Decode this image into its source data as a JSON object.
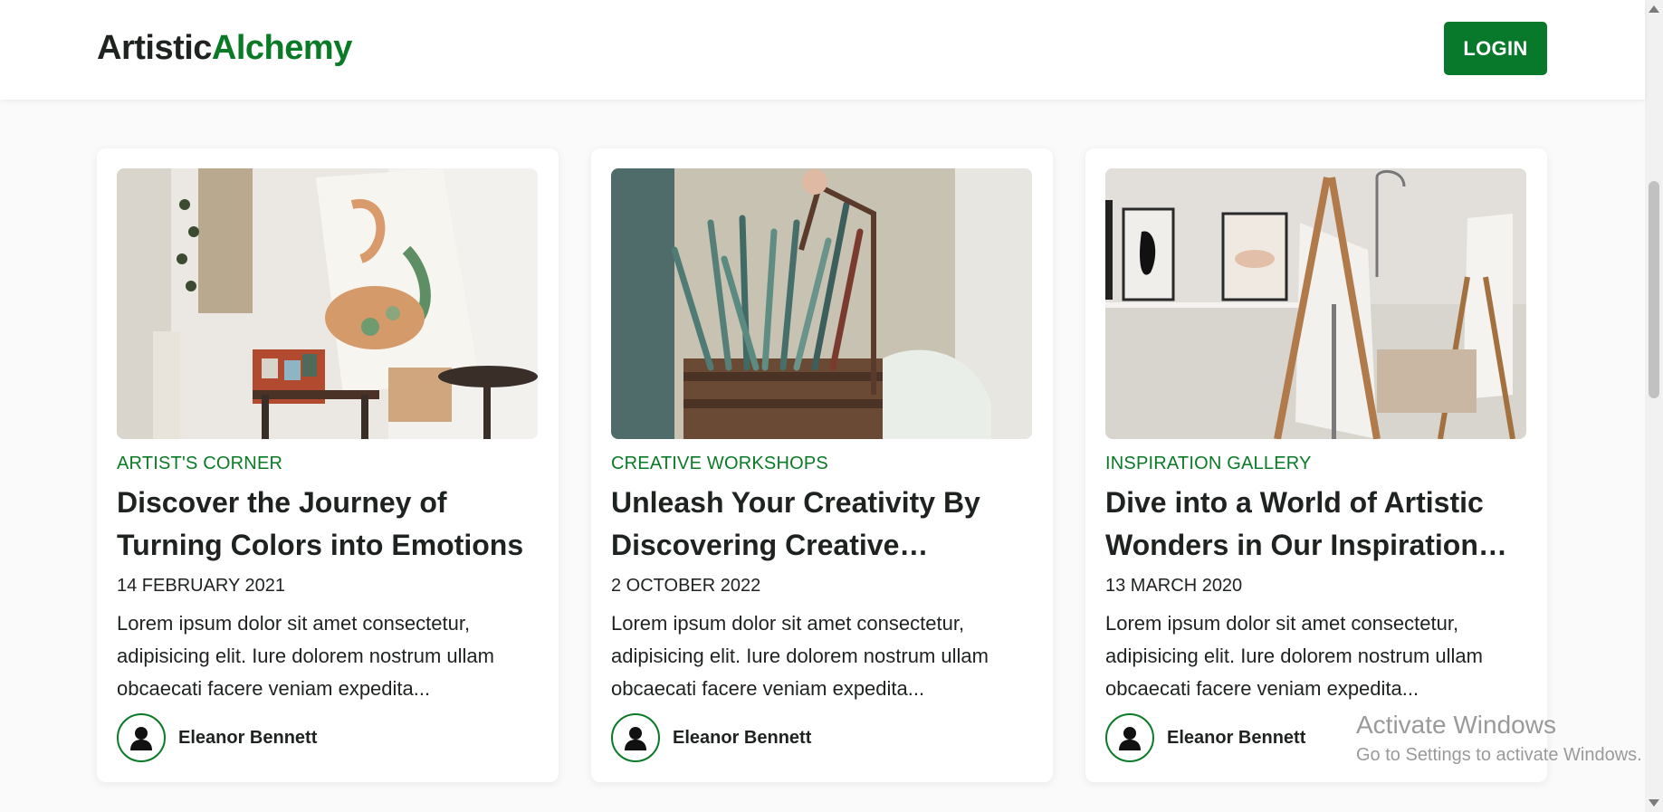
{
  "header": {
    "logo_part1": "Artistic",
    "logo_part2": "Alchemy",
    "login_label": "LOGIN"
  },
  "cards": [
    {
      "category": "ARTIST'S CORNER",
      "title": "Discover the Journey of Turning Colors into Emotions",
      "date": "14 FEBRUARY 2021",
      "excerpt": "Lorem ipsum dolor sit amet consectetur, adipisicing elit. Iure dolorem nostrum ullam obcaecati facere veniam expedita...",
      "author": "Eleanor Bennett",
      "image": "art-studio-easel-photo"
    },
    {
      "category": "CREATIVE WORKSHOPS",
      "title": "Unleash Your Creativity By Discovering Creative Workshops",
      "date": "2 OCTOBER 2022",
      "excerpt": "Lorem ipsum dolor sit amet consectetur, adipisicing elit. Iure dolorem nostrum ullam obcaecati facere veniam expedita...",
      "author": "Eleanor Bennett",
      "image": "paintbrush-crate-photo"
    },
    {
      "category": "INSPIRATION GALLERY",
      "title": "Dive into a World of Artistic Wonders in Our Inspiration Gallery",
      "date": "13 MARCH 2020",
      "excerpt": "Lorem ipsum dolor sit amet consectetur, adipisicing elit. Iure dolorem nostrum ullam obcaecati facere veniam expedita...",
      "author": "Eleanor Bennett",
      "image": "gallery-easels-photo"
    }
  ],
  "watermark": {
    "line1": "Activate Windows",
    "line2": "Go to Settings to activate Windows."
  },
  "colors": {
    "brand_green": "#0a7a26",
    "login_bg": "#08782a",
    "text": "#1f2320"
  }
}
